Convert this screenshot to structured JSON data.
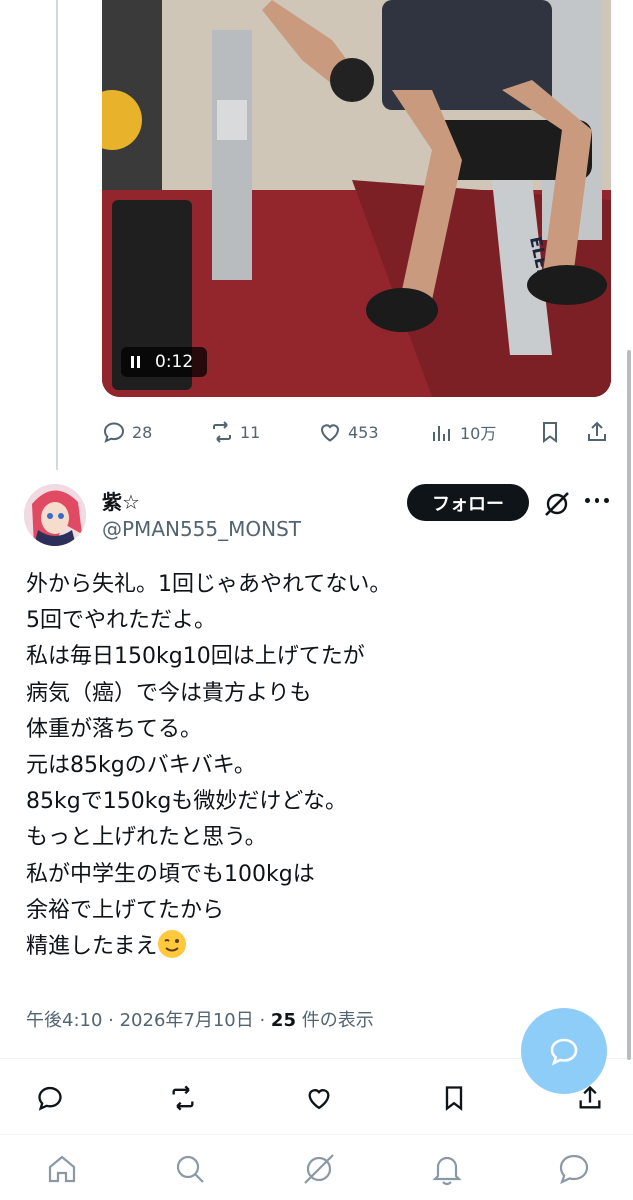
{
  "video": {
    "timestamp": "0:12",
    "bench_brand": "ELEIKO"
  },
  "prev_post_stats": {
    "replies": "28",
    "reposts": "11",
    "likes": "453",
    "views": "10万"
  },
  "reply": {
    "author_name": "紫☆",
    "author_handle": "@PMAN555_MONST",
    "follow_label": "フォロー",
    "lines": [
      "外から失礼。1回じゃあやれてない。",
      "5回でやれただよ。",
      "私は毎日150kg10回は上げてたが",
      "病気（癌）で今は貴方よりも",
      "体重が落ちてる。",
      "元は85kgのバキバキ。",
      "85kgで150kgも微妙だけどな。",
      "もっと上げれたと思う。",
      "私が中学生の頃でも100kgは",
      "余裕で上げてたから",
      "精進したまえ"
    ],
    "meta_time": "午後4:10 · 2026年7月10日 · ",
    "meta_views_count": "25",
    "meta_views_suffix": " 件の表示"
  },
  "icons": {
    "reply": "reply-icon",
    "repost": "repost-icon",
    "like": "heart-icon",
    "views": "views-icon",
    "bookmark": "bookmark-icon",
    "share": "share-icon",
    "grok": "grok-icon",
    "more": "more-icon",
    "compose": "compose-reply-icon",
    "nav": [
      "home-icon",
      "search-icon",
      "grok-icon",
      "notifications-icon",
      "messages-icon"
    ]
  },
  "colors": {
    "text": "#0f1419",
    "secondary": "#536471",
    "fab": "#8ecdf8",
    "follow_bg": "#0f1419"
  }
}
